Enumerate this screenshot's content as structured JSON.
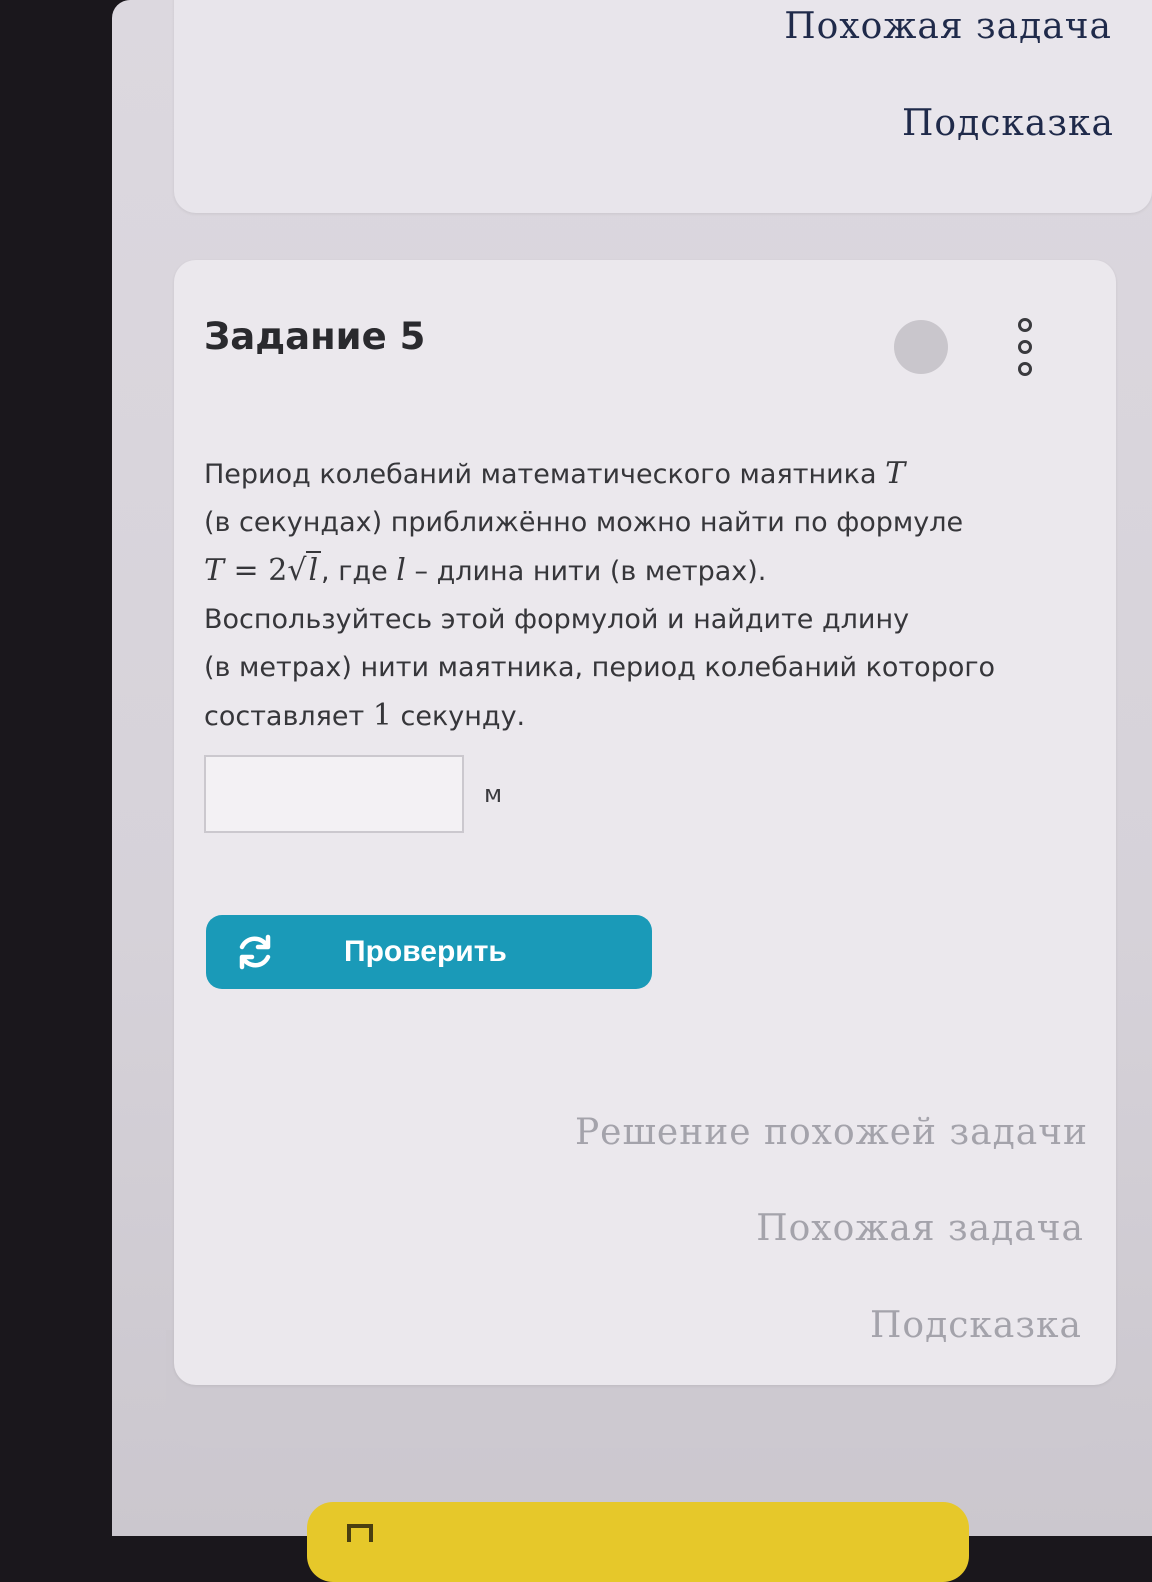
{
  "top_card": {
    "similar_task": "Похожая задача",
    "hint": "Подсказка"
  },
  "task": {
    "title": "Задание 5",
    "text": {
      "l1": "Период колебаний математического маятника",
      "var_T": "T",
      "l2": "(в секундах) приближённо можно найти по формуле",
      "formula_lhs": "T",
      "formula_eq": " = 2",
      "formula_rad": "l",
      "l3_mid": ", где",
      "var_l": "l",
      "l3_end": "– длина нити (в метрах).",
      "l4": "Воспользуйтесь этой формулой и найдите длину",
      "l5": "(в метрах) нити маятника, период колебаний которого",
      "l6_start": "составляет",
      "l6_num": "1",
      "l6_end": "секунду."
    },
    "answer": {
      "value": "",
      "unit": "м"
    },
    "check_button": "Проверить",
    "links": {
      "solution": "Решение похожей задачи",
      "similar": "Похожая задача",
      "hint": "Подсказка"
    }
  },
  "colors": {
    "accent": "#1a9ab8",
    "link_dark": "#1f2a4a",
    "link_muted": "#a4a3ab",
    "yellow": "#e6c82a"
  }
}
